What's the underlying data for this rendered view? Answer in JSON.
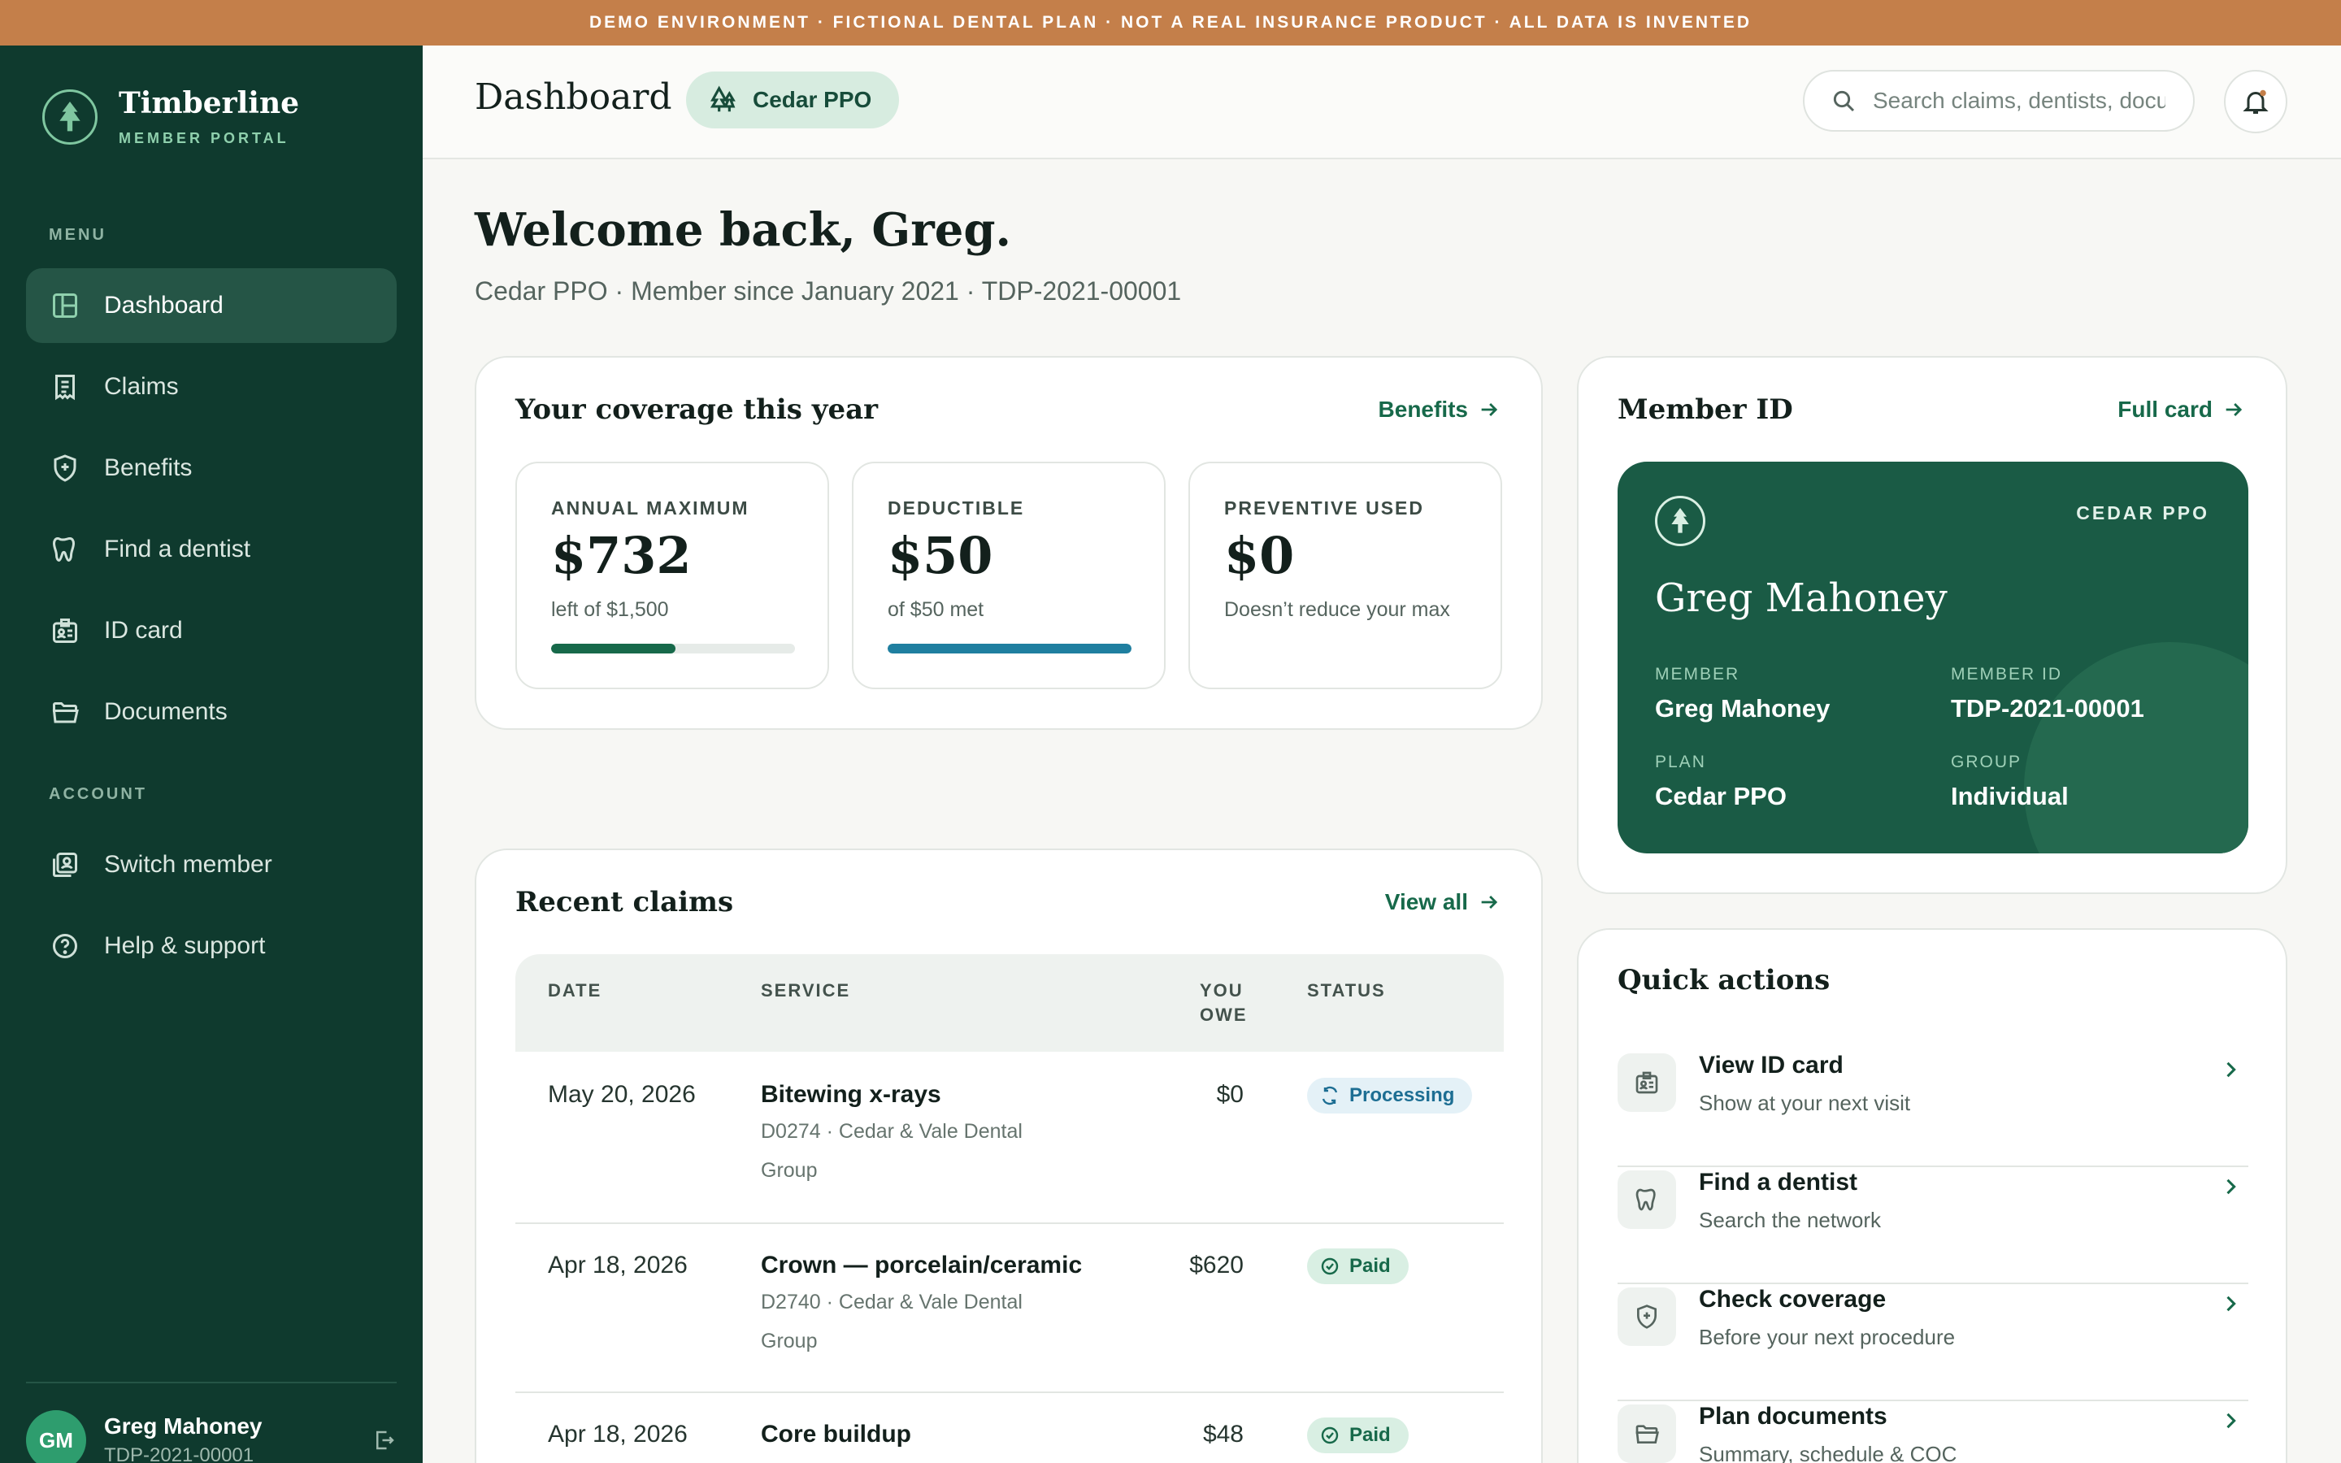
{
  "banner": "DEMO ENVIRONMENT · FICTIONAL DENTAL PLAN · NOT A REAL INSURANCE PRODUCT · ALL DATA IS INVENTED",
  "brand": {
    "name": "Timberline",
    "sub": "MEMBER PORTAL"
  },
  "sidebar": {
    "menu_label": "MENU",
    "items": [
      {
        "label": "Dashboard",
        "icon": "dashboard-icon",
        "active": true
      },
      {
        "label": "Claims",
        "icon": "receipt-icon"
      },
      {
        "label": "Benefits",
        "icon": "shield-icon"
      },
      {
        "label": "Find a dentist",
        "icon": "tooth-icon"
      },
      {
        "label": "ID card",
        "icon": "id-card-icon"
      },
      {
        "label": "Documents",
        "icon": "folder-icon"
      }
    ],
    "account_label": "ACCOUNT",
    "account_items": [
      {
        "label": "Switch member",
        "icon": "switch-user-icon"
      },
      {
        "label": "Help & support",
        "icon": "help-icon"
      }
    ],
    "user": {
      "initials": "GM",
      "name": "Greg Mahoney",
      "id": "TDP-2021-00001"
    }
  },
  "header": {
    "title": "Dashboard",
    "plan_pill": "Cedar PPO",
    "search_placeholder": "Search claims, dentists, documents"
  },
  "welcome": {
    "title": "Welcome back, Greg.",
    "subtitle": "Cedar PPO · Member since January 2021 · TDP-2021-00001"
  },
  "coverage": {
    "title": "Your coverage this year",
    "link": "Benefits",
    "stats": [
      {
        "label": "ANNUAL MAXIMUM",
        "value": "$732",
        "note": "left of $1,500",
        "progress": 0.51,
        "color": "#17694a"
      },
      {
        "label": "DEDUCTIBLE",
        "value": "$50",
        "note": "of $50 met",
        "progress": 1.0,
        "color": "#1f7fa0"
      },
      {
        "label": "PREVENTIVE USED",
        "value": "$0",
        "note": "Doesn’t reduce your max"
      }
    ]
  },
  "claims": {
    "title": "Recent claims",
    "link": "View all",
    "columns": {
      "date": "DATE",
      "service": "SERVICE",
      "owe_1": "YOU",
      "owe_2": "OWE",
      "status": "STATUS"
    },
    "rows": [
      {
        "date": "May 20, 2026",
        "service": "Bitewing x-rays",
        "detail": "D0274 · Cedar & Vale Dental Group",
        "owe": "$0",
        "status": "Processing"
      },
      {
        "date": "Apr 18, 2026",
        "service": "Crown — porcelain/ceramic",
        "detail": "D2740 · Cedar & Vale Dental Group",
        "owe": "$620",
        "status": "Paid"
      },
      {
        "date": "Apr 18, 2026",
        "service": "Core buildup",
        "detail": "",
        "owe": "$48",
        "status": "Paid"
      }
    ]
  },
  "member_id": {
    "title": "Member ID",
    "link": "Full card",
    "card": {
      "plan": "CEDAR PPO",
      "name": "Greg Mahoney",
      "member_label": "MEMBER",
      "member_value": "Greg Mahoney",
      "id_label": "MEMBER ID",
      "id_value": "TDP-2021-00001",
      "plan_label": "PLAN",
      "plan_value": "Cedar PPO",
      "group_label": "GROUP",
      "group_value": "Individual"
    }
  },
  "quick_actions": {
    "title": "Quick actions",
    "items": [
      {
        "title": "View ID card",
        "sub": "Show at your next visit",
        "icon": "id-card-icon"
      },
      {
        "title": "Find a dentist",
        "sub": "Search the network",
        "icon": "tooth-icon"
      },
      {
        "title": "Check coverage",
        "sub": "Before your next procedure",
        "icon": "shield-icon"
      },
      {
        "title": "Plan documents",
        "sub": "Summary, schedule & COC",
        "icon": "folder-icon"
      }
    ]
  },
  "colors": {
    "sidebar": "#0f3a2e",
    "accent": "#17694a",
    "banner": "#c47f4a",
    "card": "#1a5b45"
  }
}
